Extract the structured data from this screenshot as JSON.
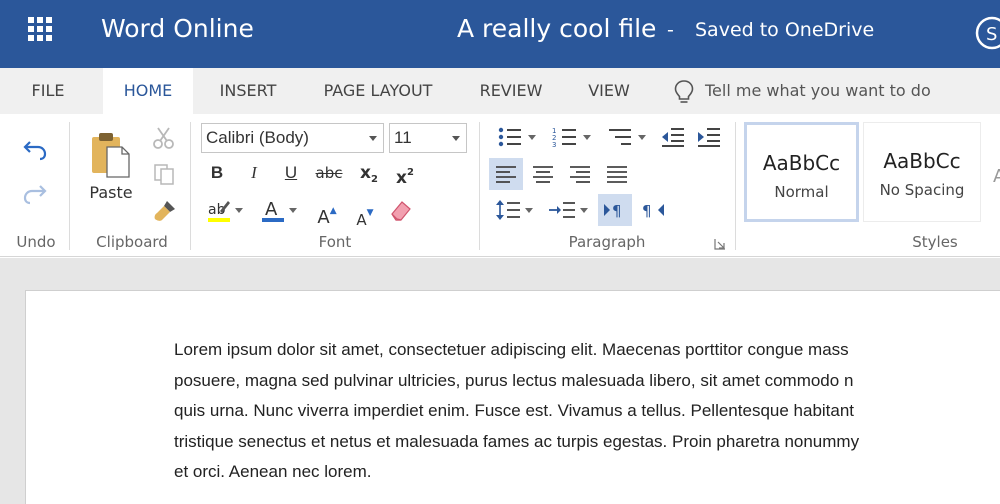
{
  "app": {
    "name": "Word Online",
    "document_title": "A really cool file",
    "save_separator": "-",
    "save_status": "Saved to OneDrive",
    "brand_color": "#2b579a"
  },
  "tabs": [
    {
      "label": "FILE",
      "active": false
    },
    {
      "label": "HOME",
      "active": true
    },
    {
      "label": "INSERT",
      "active": false
    },
    {
      "label": "PAGE LAYOUT",
      "active": false
    },
    {
      "label": "REVIEW",
      "active": false
    },
    {
      "label": "VIEW",
      "active": false
    }
  ],
  "tell_me": {
    "placeholder": "Tell me what you want to do",
    "icon": "lightbulb-icon"
  },
  "ribbon": {
    "undo_group": {
      "label": "Undo",
      "undo_icon": "undo-icon",
      "redo_icon": "redo-icon"
    },
    "clipboard_group": {
      "label": "Clipboard",
      "paste_label": "Paste",
      "cut_icon": "scissors-icon",
      "copy_icon": "copy-icon",
      "format_painter_icon": "paintbrush-icon"
    },
    "font_group": {
      "label": "Font",
      "font_name": "Calibri (Body)",
      "font_size": "11",
      "bold": "B",
      "italic": "I",
      "underline": "U",
      "strikethrough": "abc",
      "subscript_base": "x",
      "subscript_mark": "2",
      "superscript_base": "x",
      "superscript_mark": "2",
      "grow_font": "A",
      "shrink_font": "A",
      "highlight_color": "#ffff00",
      "font_color": "#2b6ac4"
    },
    "paragraph_group": {
      "label": "Paragraph",
      "active_alignment": "left"
    },
    "styles_group": {
      "label": "Styles",
      "styles": [
        {
          "sample": "AaBbCc",
          "name": "Normal",
          "selected": true
        },
        {
          "sample": "AaBbCc",
          "name": "No Spacing",
          "selected": false
        }
      ]
    }
  },
  "document": {
    "lines": [
      "Lorem ipsum dolor sit amet, consectetuer adipiscing elit. Maecenas porttitor congue mass",
      "posuere, magna sed pulvinar ultricies, purus lectus malesuada libero, sit amet commodo n",
      "quis urna. Nunc viverra imperdiet enim. Fusce est. Vivamus a tellus. Pellentesque habitant",
      "tristique senectus et netus et malesuada fames ac turpis egestas. Proin pharetra nonummy",
      "et orci. Aenean nec lorem."
    ]
  }
}
